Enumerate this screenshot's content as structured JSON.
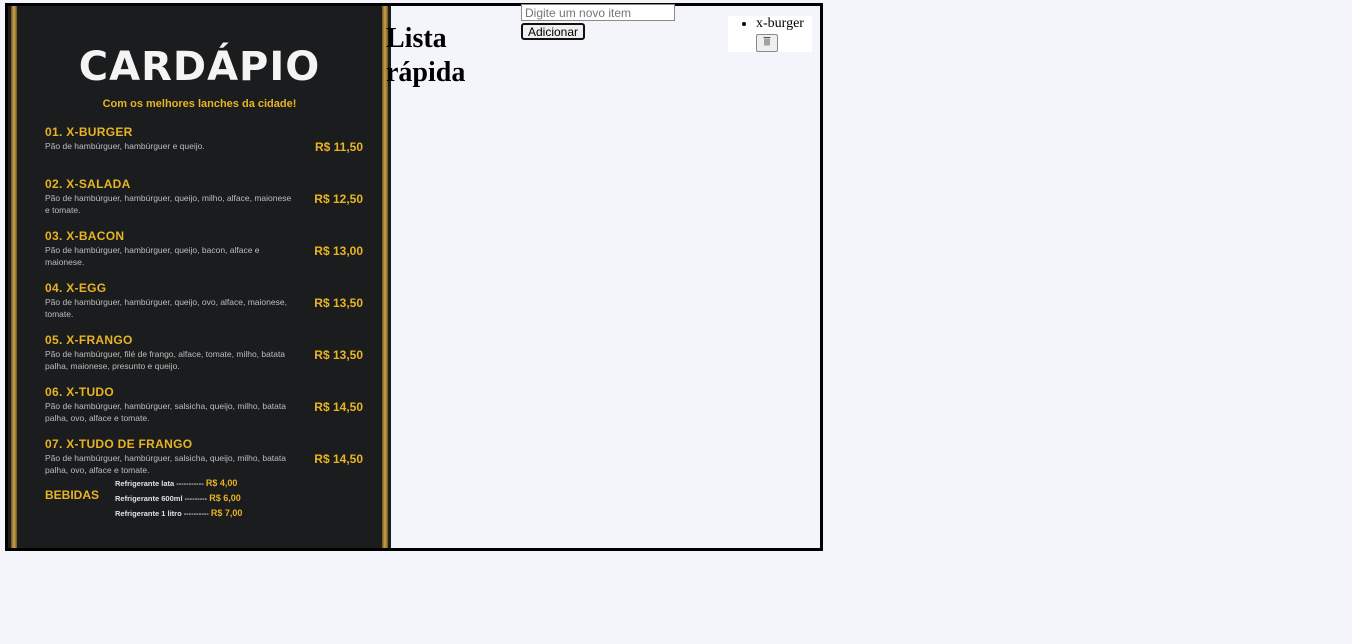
{
  "menu": {
    "title": "CARDÁPIO",
    "subtitle": "Com os melhores lanches da cidade!",
    "items": [
      {
        "name": "01. X-BURGER",
        "desc": "Pão de hambúrguer, hambúrguer e queijo.",
        "price": "R$ 11,50"
      },
      {
        "name": "02. X-SALADA",
        "desc": "Pão de hambúrguer, hambúrguer, queijo, milho, alface, maionese e tomate.",
        "price": "R$ 12,50"
      },
      {
        "name": "03. X-BACON",
        "desc": "Pão de hambúrguer, hambúrguer, queijo, bacon, alface e maionese.",
        "price": "R$ 13,00"
      },
      {
        "name": "04. X-EGG",
        "desc": "Pão de hambúrguer, hambúrguer, queijo, ovo, alface, maionese, tomate.",
        "price": "R$ 13,50"
      },
      {
        "name": "05. X-FRANGO",
        "desc": "Pão de hambúrguer, filé de frango, alface, tomate, milho, batata palha, maionese, presunto e queijo.",
        "price": "R$ 13,50"
      },
      {
        "name": "06. X-TUDO",
        "desc": "Pão de hambúrguer, hambúrguer, salsicha, queijo, milho, batata palha, ovo, alface e tomate.",
        "price": "R$ 14,50"
      },
      {
        "name": "07. X-TUDO DE FRANGO",
        "desc": "Pão de hambúrguer, hambúrguer, salsicha, queijo, milho, batata palha, ovo, alface e tomate.",
        "price": "R$ 14,50"
      }
    ],
    "drinks": {
      "label": "BEBIDAS",
      "rows": [
        {
          "name": "Refrigerante lata",
          "dots": "-----------",
          "price": "R$ 4,00"
        },
        {
          "name": "Refrigerante 600ml",
          "dots": "---------",
          "price": "R$ 6,00"
        },
        {
          "name": "Refrigerante 1 litro",
          "dots": "----------",
          "price": "R$ 7,00"
        }
      ]
    }
  },
  "page": {
    "heading": "Lista rápida"
  },
  "form": {
    "placeholder": "Digite um novo item",
    "value": "",
    "add_label": "Adicionar"
  },
  "list": {
    "items": [
      {
        "text": "x-burger",
        "delete_icon": "trash-icon"
      }
    ]
  }
}
